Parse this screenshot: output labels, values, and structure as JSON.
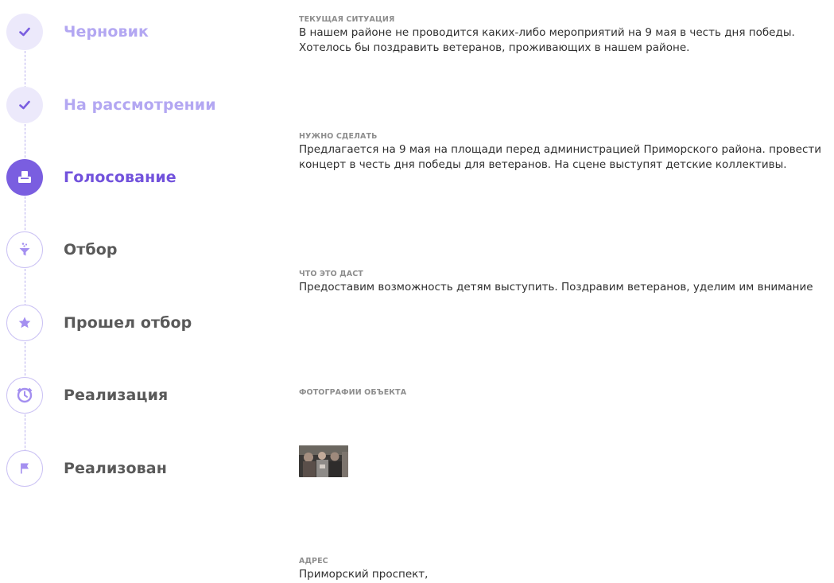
{
  "stepper": {
    "steps": [
      {
        "label": "Черновик",
        "icon": "check-icon",
        "state": "done"
      },
      {
        "label": "На рассмотрении",
        "icon": "check-icon",
        "state": "done"
      },
      {
        "label": "Голосование",
        "icon": "ballot-box-icon",
        "state": "active"
      },
      {
        "label": "Отбор",
        "icon": "filter-funnel-icon",
        "state": "future"
      },
      {
        "label": "Прошел отбор",
        "icon": "star-icon",
        "state": "future"
      },
      {
        "label": "Реализация",
        "icon": "clock-icon",
        "state": "future"
      },
      {
        "label": "Реализован",
        "icon": "flag-icon",
        "state": "future"
      }
    ]
  },
  "sections": {
    "current_situation": {
      "heading": "Текущая ситуация",
      "text": "В нашем районе не проводится каких-либо мероприятий на 9 мая в честь дня победы. Хотелось бы поздравить ветеранов, проживающих в нашем районе."
    },
    "todo": {
      "heading": "Нужно сделать",
      "text": "Предлагается на 9 мая на площади перед администрацией Приморского района. провести концерт в честь дня победы для ветеранов. На сцене выступят детские коллективы."
    },
    "result": {
      "heading": "Что это даст",
      "text": "Предоставим возможность детям выступить. Поздравим ветеранов, уделим им внимание"
    },
    "photos": {
      "heading": "Фотографии объекта"
    },
    "address": {
      "heading": "Адрес",
      "text": "Приморский проспект,"
    }
  },
  "colors": {
    "accent": "#7a5ee0",
    "done_label": "#b3a7f2",
    "done_circle": "#ece9fb",
    "future_label": "#595959",
    "future_border": "#cbc2f4"
  }
}
